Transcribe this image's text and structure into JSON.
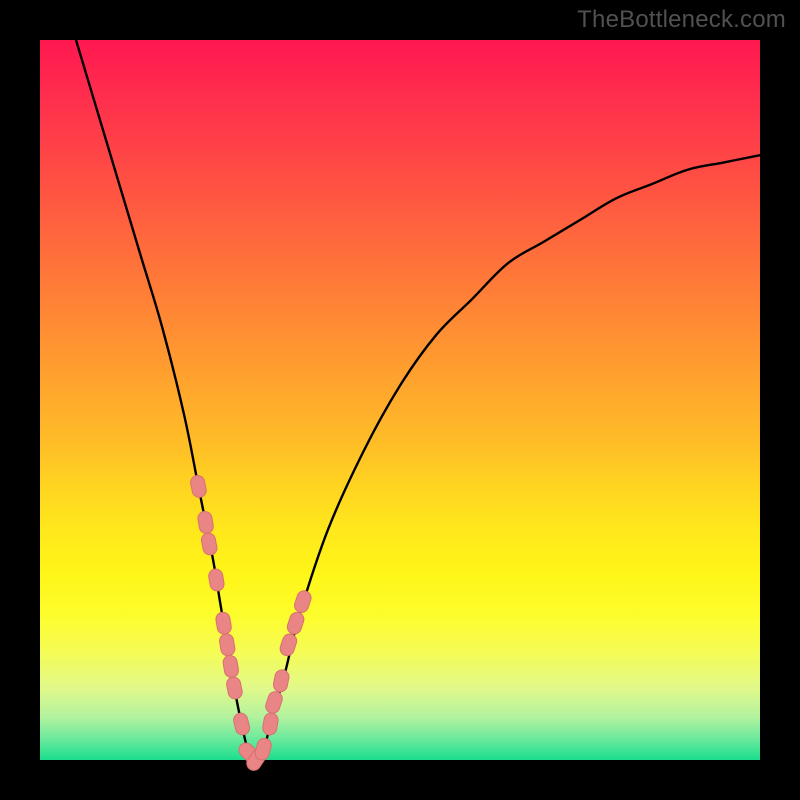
{
  "watermark": "TheBottleneck.com",
  "colors": {
    "background": "#000000",
    "gradient_top": "#ff1850",
    "gradient_mid": "#ffd421",
    "gradient_bot": "#1bde8e",
    "curve": "#000000",
    "marker_fill": "#e98585",
    "marker_stroke": "#d87070"
  },
  "chart_data": {
    "type": "line",
    "title": "",
    "xlabel": "",
    "ylabel": "",
    "xlim": [
      0,
      100
    ],
    "ylim": [
      0,
      100
    ],
    "grid": false,
    "series": [
      {
        "name": "bottleneck-curve",
        "x": [
          5,
          8,
          11,
          14,
          17,
          20,
          22,
          24,
          25,
          26,
          27,
          28,
          29,
          30,
          31,
          32,
          34,
          36,
          40,
          45,
          50,
          55,
          60,
          65,
          70,
          75,
          80,
          85,
          90,
          95,
          100
        ],
        "values": [
          100,
          90,
          80,
          70,
          60,
          48,
          38,
          28,
          22,
          16,
          10,
          5,
          1,
          0,
          1,
          5,
          12,
          20,
          32,
          43,
          52,
          59,
          64,
          69,
          72,
          75,
          78,
          80,
          82,
          83,
          84
        ]
      }
    ],
    "markers": {
      "name": "highlighted-points",
      "x": [
        22,
        23,
        23.5,
        24.5,
        25.5,
        26,
        26.5,
        27,
        28,
        29,
        30,
        31,
        32,
        32.5,
        33.5,
        34.5,
        35.5,
        36.5
      ],
      "values": [
        38,
        33,
        30,
        25,
        19,
        16,
        13,
        10,
        5,
        1,
        0,
        1.5,
        5,
        8,
        11,
        16,
        19,
        22
      ]
    },
    "annotations": []
  }
}
